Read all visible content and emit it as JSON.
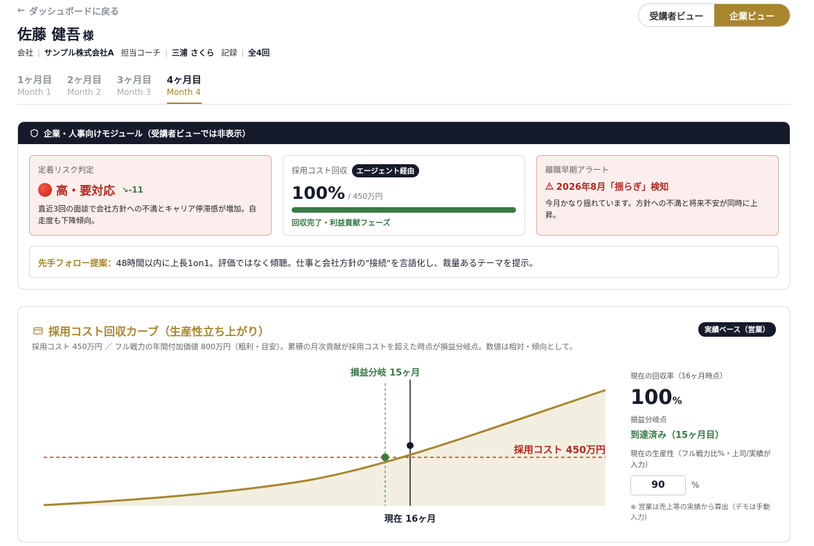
{
  "header": {
    "back_label": "ダッシュボードに戻る",
    "name": "佐藤 健吾",
    "honorific": "様",
    "meta": {
      "company_label": "会社",
      "company": "サンプル株式会社A",
      "coach_label": "担当コーチ",
      "coach": "三浦 さくら",
      "record_label": "記録",
      "record": "全4回"
    }
  },
  "view_toggle": {
    "options": [
      "受講者ビュー",
      "企業ビュー"
    ],
    "active": "企業ビュー"
  },
  "tabs": [
    {
      "jp": "1ヶ月目",
      "en": "Month 1"
    },
    {
      "jp": "2ヶ月目",
      "en": "Month 2"
    },
    {
      "jp": "3ヶ月目",
      "en": "Month 3"
    },
    {
      "jp": "4ヶ月目",
      "en": "Month 4"
    }
  ],
  "active_tab": "4ヶ月目",
  "module": {
    "title": "企業・人事向けモジュール（受講者ビューでは非表示）",
    "risk": {
      "title": "定着リスク判定",
      "status": "高・要対応",
      "trend": "-11",
      "description": "直近3回の面談で会社方針への不満とキャリア停滞感が増加。自走度も下降傾向。"
    },
    "cost": {
      "title": "採用コスト回収",
      "badge": "エージェント経由",
      "percent": "100%",
      "total": "/ 450万円",
      "progress": 1.0,
      "note": "回収完了・利益貢献フェーズ"
    },
    "alert": {
      "title": "離職早期アラート",
      "headline": "2026年8月「揺らぎ」検知",
      "description": "今月かなり揺れています。方針への不満と将来不安が同時に上昇。"
    },
    "proposal": {
      "label": "先手フォロー提案：",
      "text": "48時間以内に上長1on1。評価ではなく傾聴。仕事と会社方針の\"接続\"を言語化し、裁量あるテーマを提示。"
    }
  },
  "curve": {
    "title": "採用コスト回収カーブ（生産性立ち上がり）",
    "subtitle": "採用コスト 450万円 ／ フル戦力の年間付加価値 800万円（粗利・目安）。累積の月次貢献が採用コストを超えた時点が損益分岐点。数値は相対・傾向として。",
    "badge": "実績ベース（営業）",
    "breakeven_label": "損益分岐 15ヶ月",
    "cost_label": "採用コスト 450万円",
    "now_label": "現在 16ヶ月",
    "side": {
      "rate_label": "現在の回収率（16ヶ月時点）",
      "rate_value": "100",
      "rate_unit": "%",
      "breakeven_label": "損益分岐点",
      "breakeven_value": "到達済み（15ヶ月目）",
      "productivity_label": "現在の生産性（フル戦力比%・上司/実績が入力）",
      "productivity_value": "90",
      "productivity_unit": "%",
      "note": "※ 営業は売上等の実績から算出（デモは手動入力）"
    }
  },
  "colors": {
    "gold": "#a8862e",
    "navy": "#161b2b",
    "green": "#3a7a46",
    "red": "#b02a22"
  }
}
